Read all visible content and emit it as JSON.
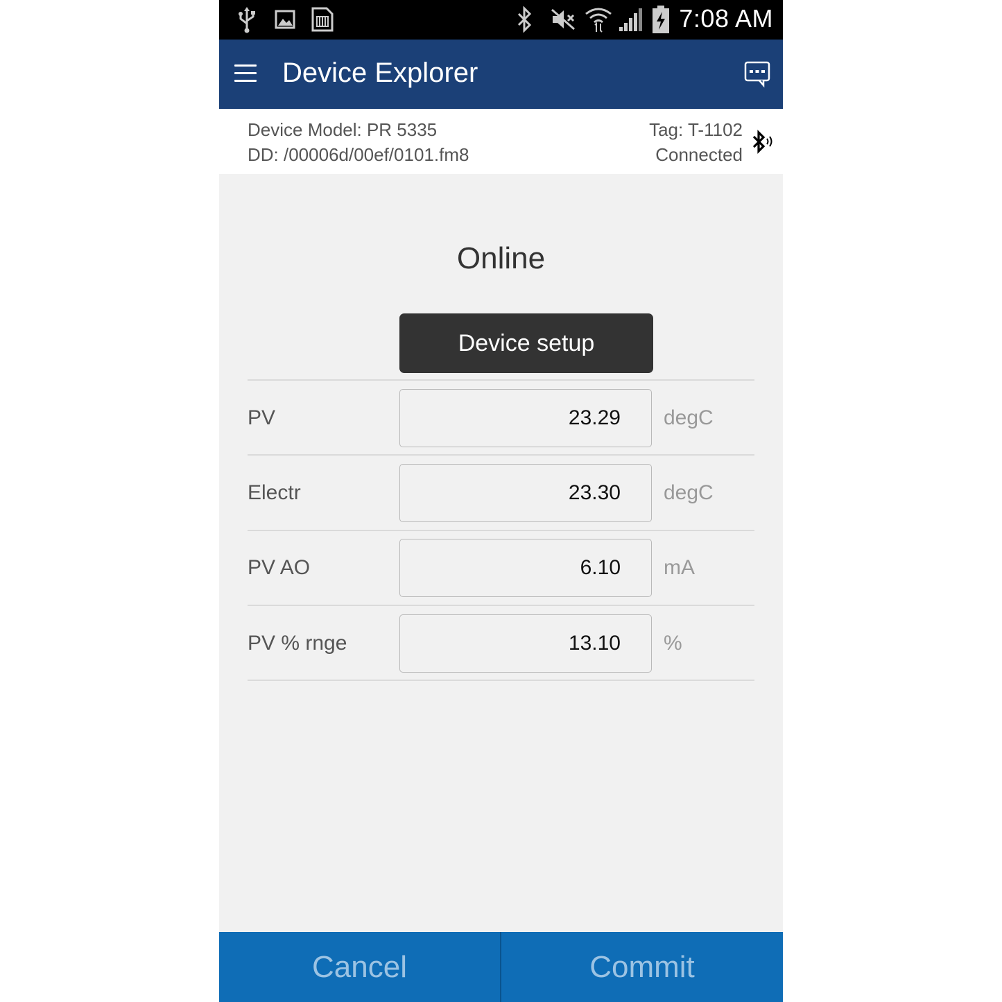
{
  "status_bar": {
    "time": "7:08 AM",
    "left_icons": [
      "usb-icon",
      "image-icon",
      "sim-card-icon"
    ],
    "right_icons": [
      "bluetooth-icon",
      "mute-icon",
      "wifi-icon",
      "signal-icon",
      "battery-charging-icon"
    ]
  },
  "app_bar": {
    "title": "Device Explorer",
    "menu_icon": "menu-icon",
    "chat_icon": "chat-icon",
    "background": "#1b4077"
  },
  "device_info": {
    "model": "Device Model:  PR 5335",
    "dd": "DD:  /00006d/00ef/0101.fm8",
    "tag": "Tag:  T-1102",
    "status": "Connected"
  },
  "section_title": "Online",
  "setup_button": "Device setup",
  "rows": [
    {
      "label": "PV",
      "value": "23.29",
      "unit": "degC"
    },
    {
      "label": "Electr",
      "value": "23.30",
      "unit": "degC"
    },
    {
      "label": "PV AO",
      "value": "6.10",
      "unit": "mA"
    },
    {
      "label": "PV % rnge",
      "value": "13.10",
      "unit": "%"
    }
  ],
  "bottom_bar": {
    "cancel": "Cancel",
    "commit": "Commit",
    "background": "#0f6db6"
  }
}
